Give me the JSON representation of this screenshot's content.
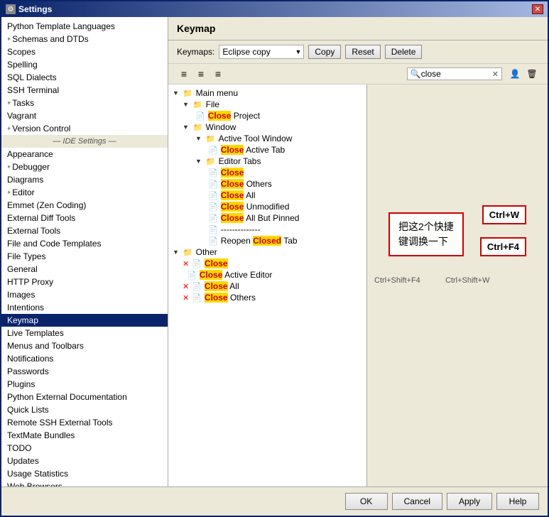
{
  "window": {
    "title": "Settings",
    "close_label": "✕"
  },
  "sidebar": {
    "items": [
      {
        "label": "Python Template Languages",
        "type": "normal"
      },
      {
        "label": "+ Schemas and DTDs",
        "type": "expandable"
      },
      {
        "label": "Scopes",
        "type": "normal"
      },
      {
        "label": "Spelling",
        "type": "normal"
      },
      {
        "label": "SQL Dialects",
        "type": "normal"
      },
      {
        "label": "SSH Terminal",
        "type": "normal"
      },
      {
        "label": "+ Tasks",
        "type": "expandable"
      },
      {
        "label": "Vagrant",
        "type": "normal"
      },
      {
        "label": "+ Version Control",
        "type": "expandable"
      },
      {
        "label": "— IDE Settings —",
        "type": "group"
      },
      {
        "label": "Appearance",
        "type": "normal"
      },
      {
        "label": "+ Debugger",
        "type": "expandable"
      },
      {
        "label": "Diagrams",
        "type": "normal"
      },
      {
        "label": "+ Editor",
        "type": "expandable"
      },
      {
        "label": "Emmet (Zen Coding)",
        "type": "normal"
      },
      {
        "label": "External Diff Tools",
        "type": "normal"
      },
      {
        "label": "External Tools",
        "type": "normal"
      },
      {
        "label": "File and Code Templates",
        "type": "normal"
      },
      {
        "label": "File Types",
        "type": "normal"
      },
      {
        "label": "General",
        "type": "normal"
      },
      {
        "label": "HTTP Proxy",
        "type": "normal"
      },
      {
        "label": "Images",
        "type": "normal"
      },
      {
        "label": "Intentions",
        "type": "normal"
      },
      {
        "label": "Keymap",
        "type": "selected"
      },
      {
        "label": "Live Templates",
        "type": "normal"
      },
      {
        "label": "Menus and Toolbars",
        "type": "normal"
      },
      {
        "label": "Notifications",
        "type": "normal"
      },
      {
        "label": "Passwords",
        "type": "normal"
      },
      {
        "label": "Plugins",
        "type": "normal"
      },
      {
        "label": "Python External Documentation",
        "type": "normal"
      },
      {
        "label": "Quick Lists",
        "type": "normal"
      },
      {
        "label": "Remote SSH External Tools",
        "type": "normal"
      },
      {
        "label": "TextMate Bundles",
        "type": "normal"
      },
      {
        "label": "TODO",
        "type": "normal"
      },
      {
        "label": "Updates",
        "type": "normal"
      },
      {
        "label": "Usage Statistics",
        "type": "normal"
      },
      {
        "label": "Web Browsers",
        "type": "normal"
      }
    ]
  },
  "keymap": {
    "panel_title": "Keymap",
    "keymaps_label": "Keymaps:",
    "selected_keymap": "Eclipse copy",
    "buttons": {
      "copy": "Copy",
      "reset": "Reset",
      "delete": "Delete"
    },
    "search_value": "close",
    "toolbar_icons": [
      "≡",
      "≡",
      "≡"
    ]
  },
  "tree": {
    "items": [
      {
        "indent": 0,
        "type": "folder",
        "label": "Main menu",
        "has_expand": true
      },
      {
        "indent": 1,
        "type": "folder",
        "label": "File",
        "has_expand": true
      },
      {
        "indent": 2,
        "type": "action",
        "label": "Close Project",
        "highlight": "Close"
      },
      {
        "indent": 1,
        "type": "folder",
        "label": "Window",
        "has_expand": true
      },
      {
        "indent": 2,
        "type": "folder",
        "label": "Active Tool Window",
        "has_expand": true
      },
      {
        "indent": 3,
        "type": "action",
        "label": "Close Active Tab",
        "highlight": "Close"
      },
      {
        "indent": 2,
        "type": "folder",
        "label": "Editor Tabs",
        "has_expand": true
      },
      {
        "indent": 3,
        "type": "action",
        "label": "Close",
        "highlight": "Close"
      },
      {
        "indent": 3,
        "type": "action",
        "label": "Close Others",
        "highlight": "Close"
      },
      {
        "indent": 3,
        "type": "action",
        "label": "Close All",
        "highlight": "Close"
      },
      {
        "indent": 3,
        "type": "action",
        "label": "Close Unmodified",
        "highlight": "Close"
      },
      {
        "indent": 3,
        "type": "action",
        "label": "Close All But Pinned",
        "highlight": "Close"
      },
      {
        "indent": 3,
        "type": "separator",
        "label": "--------------"
      },
      {
        "indent": 3,
        "type": "action",
        "label": "Reopen Closed Tab",
        "highlight": "Closed"
      },
      {
        "indent": 0,
        "type": "folder",
        "label": "Other",
        "has_expand": true
      },
      {
        "indent": 1,
        "type": "action",
        "label": "Close",
        "highlight": "Close",
        "has_x": true
      },
      {
        "indent": 1,
        "type": "action",
        "label": "Close Active Editor",
        "highlight": "Close",
        "has_x": false
      },
      {
        "indent": 1,
        "type": "action",
        "label": "Close All",
        "highlight": "Close",
        "has_x": true
      },
      {
        "indent": 1,
        "type": "action",
        "label": "Close Others",
        "highlight": "Close",
        "has_x": true
      }
    ]
  },
  "annotation": {
    "chinese_text": "把这2个快捷\n键调换一下",
    "shortcut1": "Ctrl+W",
    "shortcut2": "Ctrl+F4",
    "shortcut3": "Ctrl+Shift+F4",
    "shortcut4": "Ctrl+Shift+W"
  },
  "bottom_buttons": {
    "ok": "OK",
    "cancel": "Cancel",
    "apply": "Apply",
    "help": "Help"
  }
}
